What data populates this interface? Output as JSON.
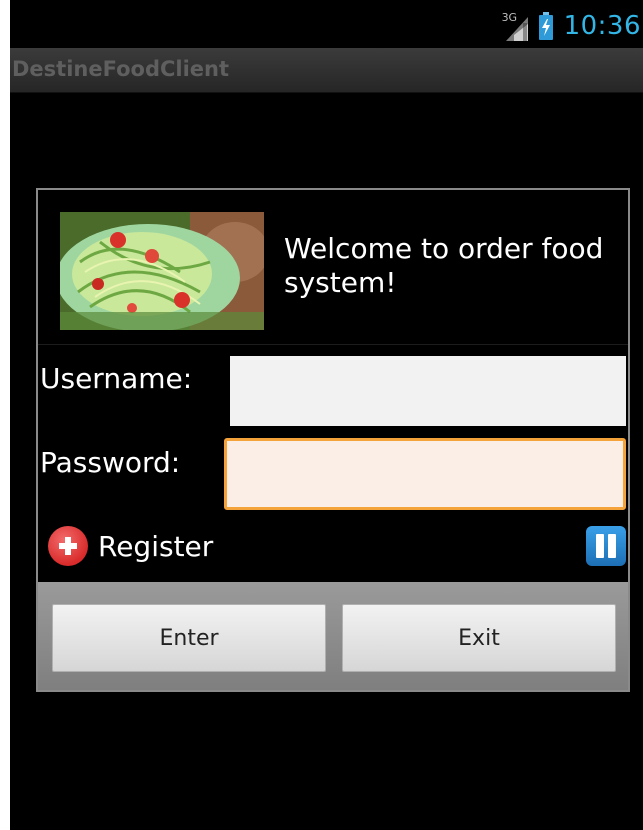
{
  "status_bar": {
    "network": "3G",
    "time": "10:36"
  },
  "app": {
    "title": "DestineFoodClient"
  },
  "dialog": {
    "welcome": "Welcome to order food system!",
    "username_label": "Username:",
    "username_value": "",
    "password_label": "Password:",
    "password_value": "",
    "register_label": "Register",
    "enter_label": "Enter",
    "exit_label": "Exit"
  },
  "icons": {
    "signal": "signal-icon",
    "battery": "battery-charging-icon",
    "register": "add-icon",
    "pause": "pause-icon",
    "image": "food-image"
  },
  "colors": {
    "clock": "#33b5e5",
    "focus_border": "#f3a33a",
    "register_icon": "#d92b2b",
    "pause_icon": "#1d6fb5"
  }
}
